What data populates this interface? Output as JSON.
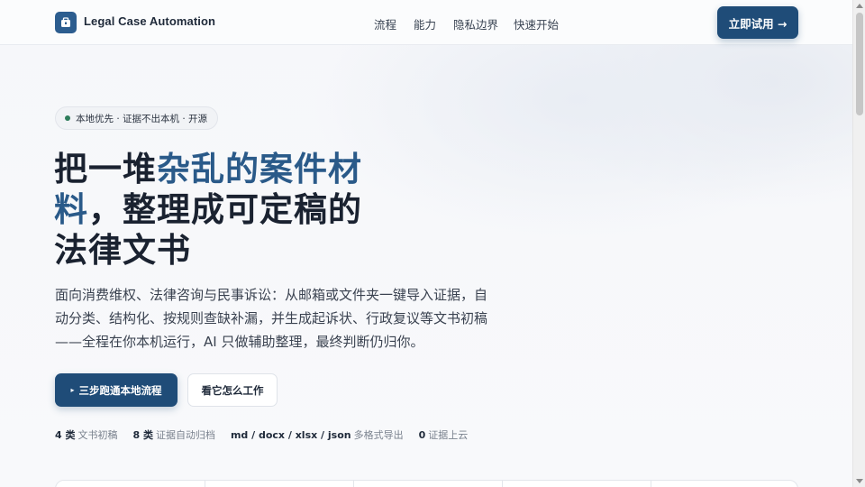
{
  "header": {
    "brand": "Legal Case Automation",
    "nav": [
      "流程",
      "能力",
      "隐私边界",
      "快速开始"
    ],
    "cta": "立即试用 →"
  },
  "hero": {
    "badge": "本地优先 · 证据不出本机 · 开源",
    "headline": {
      "line1_plain": "把一堆",
      "line1_accent": "杂乱的案件材",
      "line2_accent": "料",
      "line2_plain": "，整理成可定稿的",
      "line3": "法律文书"
    },
    "description_lines": [
      "面向消费维权、法律咨询与民事诉讼：从邮箱或文件夹一键导入证据，自",
      "动分类、结构化、按规则查缺补漏，并生成起诉状、行政复议等文书初稿",
      "——全程在你本机运行，AI 只做辅助整理，最终判断仍归你。"
    ],
    "primary_button": "三步跑通本地流程",
    "primary_icon": "▸",
    "secondary_button": "看它怎么工作"
  },
  "stats": [
    {
      "value": "4 类",
      "label": "文书初稿"
    },
    {
      "value": "8 类",
      "label": "证据自动归档"
    },
    {
      "value": "md / docx / xlsx / json",
      "label": "多格式导出"
    },
    {
      "value": "0",
      "label": "证据上云"
    }
  ],
  "colors": {
    "brand": "#1f4c78",
    "accent_text": "#2a5a89",
    "badge_dot": "#2e7d5b"
  }
}
